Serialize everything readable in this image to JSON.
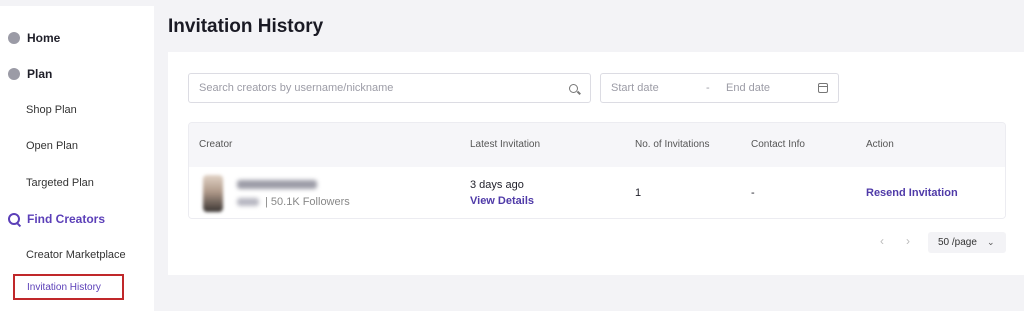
{
  "sidebar": {
    "sections": [
      {
        "label": "Home",
        "icon": "home-icon"
      },
      {
        "label": "Plan",
        "icon": "plan-icon"
      },
      {
        "label": "Find Creators",
        "icon": "search-icon"
      }
    ],
    "plan_items": [
      "Shop Plan",
      "Open Plan",
      "Targeted Plan"
    ],
    "find_items": [
      "Creator Marketplace",
      "Invitation History"
    ]
  },
  "page": {
    "title": "Invitation History"
  },
  "filters": {
    "search_placeholder": "Search creators by username/nickname",
    "start_placeholder": "Start date",
    "date_separator": "-",
    "end_placeholder": "End date"
  },
  "table": {
    "columns": [
      "Creator",
      "Latest Invitation",
      "No. of Invitations",
      "Contact Info",
      "Action"
    ],
    "rows": [
      {
        "followers": "|  50.1K Followers",
        "latest": "3 days ago",
        "view_details": "View Details",
        "count": "1",
        "contact": "-",
        "action": "Resend Invitation"
      }
    ]
  },
  "pagination": {
    "prev": "‹",
    "next": "›",
    "page_size": "50 /page",
    "chevron": "⌄"
  },
  "colors": {
    "accent": "#5b3fb8",
    "highlight_border": "#c0282a"
  }
}
